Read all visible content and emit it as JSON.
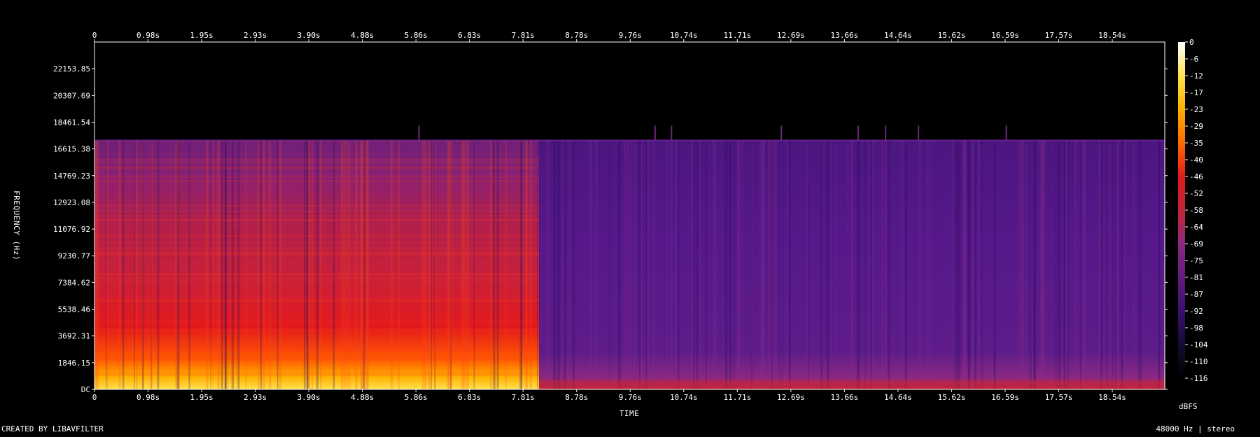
{
  "chart_data": {
    "type": "heatmap",
    "subtype": "spectrogram",
    "xlabel": "TIME",
    "ylabel": "FREQUENCY (Hz)",
    "colorbar_unit": "dBFS",
    "footer_left": "CREATED BY LIBAVFILTER",
    "footer_right": "48000 Hz | stereo",
    "x_ticks": [
      "0",
      "0.98s",
      "1.95s",
      "2.93s",
      "3.90s",
      "4.88s",
      "5.86s",
      "6.83s",
      "7.81s",
      "8.78s",
      "9.76s",
      "10.74s",
      "11.71s",
      "12.69s",
      "13.66s",
      "14.64s",
      "15.62s",
      "16.59s",
      "17.57s",
      "18.54s"
    ],
    "y_ticks": [
      "DC",
      "1846.15",
      "3692.31",
      "5538.46",
      "7384.62",
      "9230.77",
      "11076.92",
      "12923.08",
      "14769.23",
      "16615.38",
      "18461.54",
      "20307.69",
      "22153.85"
    ],
    "colorbar_ticks": [
      "0",
      "-6",
      "-12",
      "-17",
      "-23",
      "-29",
      "-35",
      "-40",
      "-46",
      "-52",
      "-58",
      "-64",
      "-69",
      "-75",
      "-81",
      "-87",
      "-92",
      "-98",
      "-104",
      "-110",
      "-116"
    ],
    "x_range_seconds": [
      0,
      19.5
    ],
    "y_range_hz": [
      0,
      24000
    ],
    "db_range": [
      -120,
      0
    ],
    "cutoff_hz": 17250,
    "segments": [
      {
        "start_s": 0,
        "end_s": 8.1,
        "level": "loud",
        "low_freq_db": -12,
        "mid_db": -45,
        "high_db": -60
      },
      {
        "start_s": 8.1,
        "end_s": 19.5,
        "level": "quiet",
        "low_freq_db": -55,
        "mid_db": -85,
        "high_db": -88
      }
    ],
    "colors": {
      "background": "#000000",
      "colormap": [
        "#000000",
        "#140b34",
        "#3b0f70",
        "#641a80",
        "#8c2981",
        "#c42438",
        "#e31a1c",
        "#ff6a00",
        "#ffb000",
        "#ffe34f",
        "#ffffff"
      ]
    }
  }
}
